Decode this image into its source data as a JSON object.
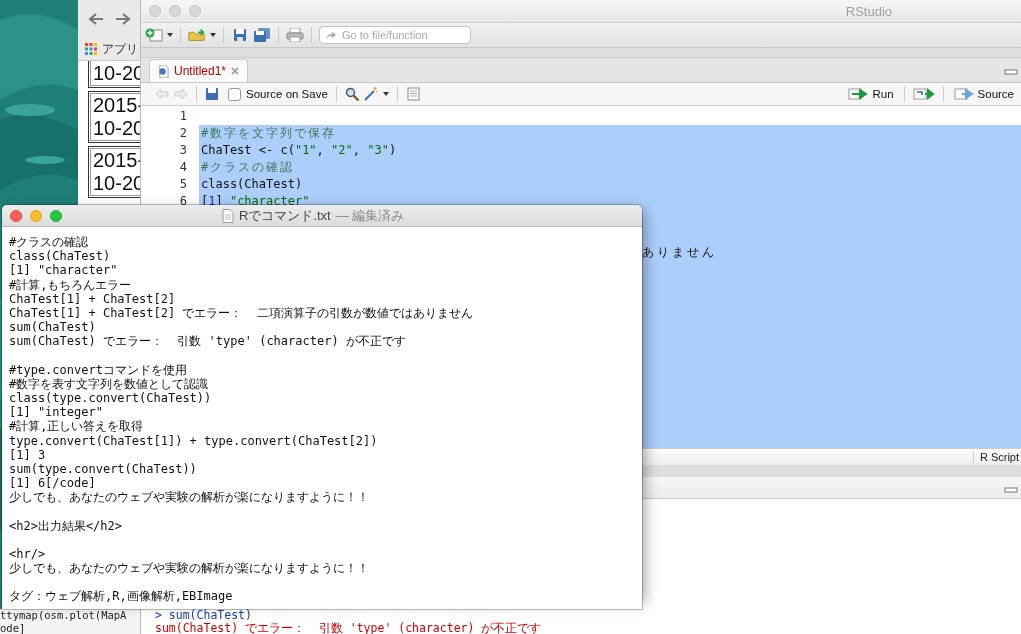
{
  "back_window": {
    "lines": [
      "ttymap(osm.plot(MapA",
      "ode]"
    ]
  },
  "browser": {
    "bookmark": "アプリ",
    "cells": [
      {
        "lines": [
          "10-20"
        ]
      },
      {
        "lines": [
          "2015-",
          "10-20"
        ]
      },
      {
        "lines": [
          "2015-",
          "10-20"
        ]
      }
    ]
  },
  "rstudio": {
    "title": "RStudio",
    "search": {
      "placeholder": "Go to file/function"
    },
    "tabs": [
      {
        "label": "Untitled1*",
        "selected": true,
        "modified": true
      }
    ],
    "source_on_save": {
      "label": "Source on Save",
      "checked": false
    },
    "run": "Run",
    "source": "Source",
    "lines": [
      {
        "number": "1",
        "selected": false
      },
      {
        "number": "2",
        "selected": true,
        "segments": [
          {
            "text": "#数字を文字列で保存",
            "kind": "comment"
          }
        ]
      },
      {
        "number": "3",
        "selected": true,
        "segments": [
          {
            "text": "ChaTest <- c(",
            "kind": "plain"
          },
          {
            "text": "\"1\"",
            "kind": "string"
          },
          {
            "text": ", ",
            "kind": "plain"
          },
          {
            "text": "\"2\"",
            "kind": "string"
          },
          {
            "text": ", ",
            "kind": "plain"
          },
          {
            "text": "\"3\"",
            "kind": "string"
          },
          {
            "text": ")",
            "kind": "plain"
          }
        ]
      },
      {
        "number": "4",
        "selected": true,
        "segments": [
          {
            "text": "#クラスの確認",
            "kind": "comment"
          }
        ]
      },
      {
        "number": "5",
        "selected": true,
        "segments": [
          {
            "text": "class(ChaTest)",
            "kind": "plain"
          }
        ]
      },
      {
        "number": "6",
        "selected": true,
        "segments": [
          {
            "text": "[",
            "kind": "plain"
          },
          {
            "text": "1",
            "kind": "number"
          },
          {
            "text": "] ",
            "kind": "plain"
          },
          {
            "text": "\"character\"",
            "kind": "string"
          }
        ]
      },
      {
        "selected": true
      },
      {
        "selected": true
      },
      {
        "selected": true,
        "tail": "ありません"
      }
    ],
    "status": {
      "file_type": "R Script"
    },
    "console": [
      {
        "text": "> sum(ChaTest)",
        "kind": "input"
      },
      {
        "text": "sum(ChaTest) でエラー：  引数 'type' (character) が不正です",
        "kind": "error"
      }
    ]
  },
  "textedit": {
    "filename": "Rでコマンド.txt",
    "status": "— 編集済み",
    "blocks": [
      {
        "lines": [
          "#クラスの確認",
          "class(ChaTest)",
          "[1] \"character\"",
          "#計算,もちろんエラー",
          "ChaTest[1] + ChaTest[2]",
          "ChaTest[1] + ChaTest[2] でエラー：  二項演算子の引数が数値ではありません",
          "sum(ChaTest)",
          "sum(ChaTest) でエラー：  引数 'type' (character) が不正です"
        ]
      },
      {
        "lines": [
          "#type.convertコマンドを使用",
          "#数字を表す文字列を数値として認識",
          "class(type.convert(ChaTest))",
          "[1] \"integer\"",
          "#計算,正しい答えを取得",
          "type.convert(ChaTest[1]) + type.convert(ChaTest[2])",
          "[1] 3",
          "sum(type.convert(ChaTest))",
          "[1] 6[/code]",
          "少しでも、あなたのウェブや実験の解析が楽になりますように！！"
        ]
      },
      {
        "lines": [
          "<h2>出力結果</h2>"
        ]
      },
      {
        "lines": [
          "<hr/>",
          "少しでも、あなたのウェブや実験の解析が楽になりますように！！"
        ]
      },
      {
        "lines": [
          "タグ：ウェブ解析,R,画像解析,EBImage"
        ]
      }
    ]
  }
}
